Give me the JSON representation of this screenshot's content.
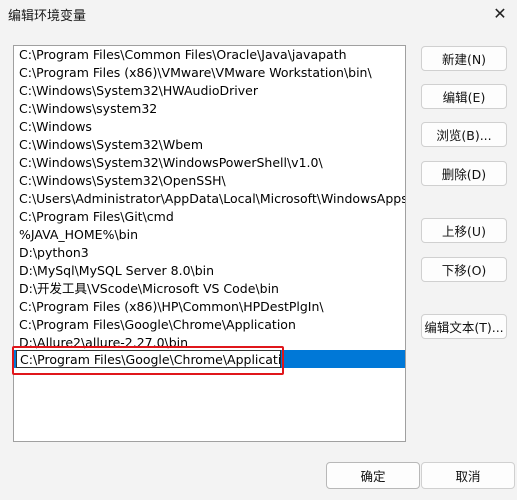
{
  "window": {
    "title": "编辑环境变量"
  },
  "list": {
    "items": [
      "C:\\Program Files\\Common Files\\Oracle\\Java\\javapath",
      "C:\\Program Files (x86)\\VMware\\VMware Workstation\\bin\\",
      "C:\\Windows\\System32\\HWAudioDriver",
      "C:\\Windows\\system32",
      "C:\\Windows",
      "C:\\Windows\\System32\\Wbem",
      "C:\\Windows\\System32\\WindowsPowerShell\\v1.0\\",
      "C:\\Windows\\System32\\OpenSSH\\",
      "C:\\Users\\Administrator\\AppData\\Local\\Microsoft\\WindowsApps",
      "C:\\Program Files\\Git\\cmd",
      "%JAVA_HOME%\\bin",
      "D:\\python3",
      "D:\\MySql\\MySQL Server 8.0\\bin",
      "D:\\开发工具\\VScode\\Microsoft VS Code\\bin",
      "C:\\Program Files (x86)\\HP\\Common\\HPDestPlgIn\\",
      "C:\\Program Files\\Google\\Chrome\\Application",
      "D:\\Allure2\\allure-2.27.0\\bin"
    ],
    "editing_value": "C:\\Program Files\\Google\\Chrome\\Application"
  },
  "buttons": {
    "new": "新建(N)",
    "edit": "编辑(E)",
    "browse": "浏览(B)...",
    "delete": "删除(D)",
    "move_up": "上移(U)",
    "move_down": "下移(O)",
    "edit_text": "编辑文本(T)...",
    "ok": "确定",
    "cancel": "取消"
  },
  "colors": {
    "selection": "#0078d7",
    "highlight_annotation": "#e0161b"
  }
}
